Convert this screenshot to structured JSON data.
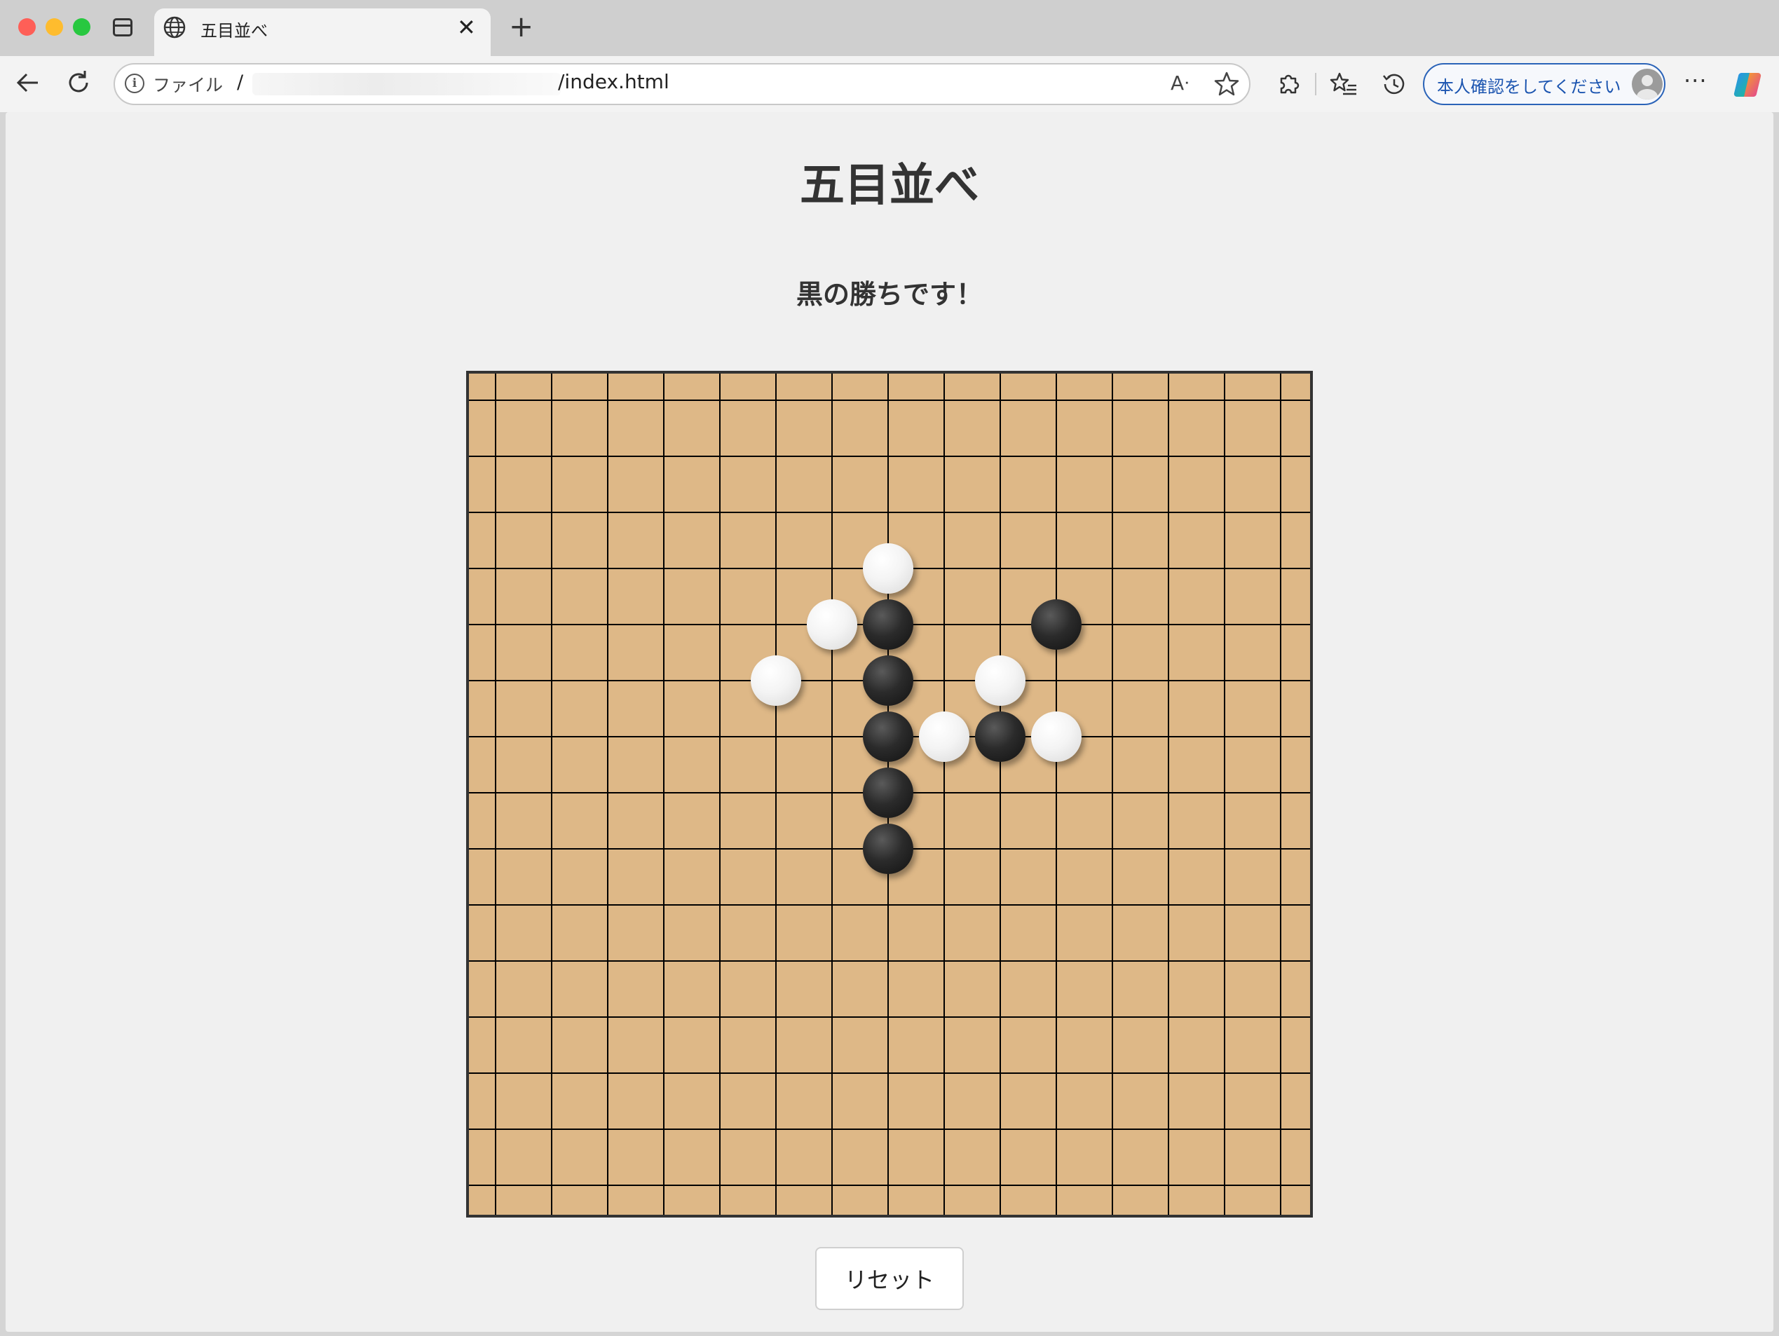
{
  "browser": {
    "tab_title": "五目並べ",
    "new_tab_glyph": "+",
    "close_glyph": "✕",
    "address": {
      "security_label": "ファイル",
      "url_prefix": "/",
      "url_visible": "/index.html"
    },
    "read_aloud_glyph": "Aᐧ",
    "signin_label": "本人確認をしてください",
    "more_glyph": "···"
  },
  "page": {
    "title": "五目並べ",
    "status": "黒の勝ちです！",
    "reset_label": "リセット"
  },
  "board": {
    "lines": 15,
    "board_color": "#deb887",
    "line_color": "#000000",
    "winner": "black",
    "stones": [
      {
        "color": "white",
        "col": 7,
        "row": 3
      },
      {
        "color": "white",
        "col": 6,
        "row": 4
      },
      {
        "color": "black",
        "col": 7,
        "row": 4
      },
      {
        "color": "black",
        "col": 10,
        "row": 4
      },
      {
        "color": "white",
        "col": 5,
        "row": 5
      },
      {
        "color": "black",
        "col": 7,
        "row": 5
      },
      {
        "color": "white",
        "col": 9,
        "row": 5
      },
      {
        "color": "black",
        "col": 7,
        "row": 6
      },
      {
        "color": "white",
        "col": 8,
        "row": 6
      },
      {
        "color": "black",
        "col": 9,
        "row": 6
      },
      {
        "color": "white",
        "col": 10,
        "row": 6
      },
      {
        "color": "black",
        "col": 7,
        "row": 7
      },
      {
        "color": "black",
        "col": 7,
        "row": 8
      }
    ]
  }
}
